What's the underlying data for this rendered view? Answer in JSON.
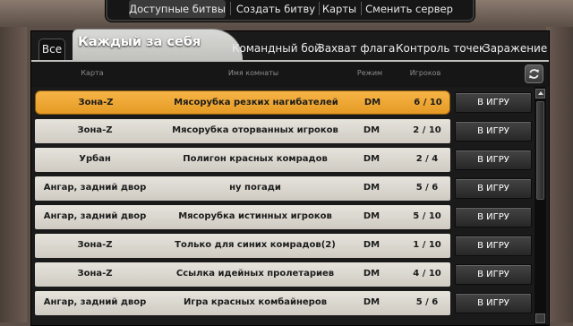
{
  "top_menu": {
    "items": [
      "Доступные битвы",
      "Создать битву",
      "Карты",
      "Сменить сервер"
    ],
    "active_index": 0
  },
  "tabs": {
    "all": "Все",
    "active": "Каждый за себя",
    "others": [
      "Командный бой",
      "Захват флага",
      "Контроль точек",
      "Заражение"
    ]
  },
  "table": {
    "headers": {
      "map": "Карта",
      "room": "Имя комнаты",
      "mode": "Режим",
      "players": "Игроков"
    },
    "refresh_icon": "refresh-icon",
    "rows": [
      {
        "map": "Зона-Z",
        "room": "Мясорубка резких нагибателей",
        "mode": "DM",
        "players": "6 / 10",
        "button": "В ИГРУ",
        "selected": true
      },
      {
        "map": "Зона-Z",
        "room": "Мясорубка оторванных игроков",
        "mode": "DM",
        "players": "2 / 10",
        "button": "В ИГРУ"
      },
      {
        "map": "Урбан",
        "room": "Полигон красных комрадов",
        "mode": "DM",
        "players": "2 / 4",
        "button": "В ИГРУ"
      },
      {
        "map": "Ангар, задний двор",
        "room": "ну погади",
        "mode": "DM",
        "players": "5 / 6",
        "button": "В ИГРУ"
      },
      {
        "map": "Ангар, задний двор",
        "room": "Мясорубка истинных игроков",
        "mode": "DM",
        "players": "5 / 10",
        "button": "В ИГРУ"
      },
      {
        "map": "Зона-Z",
        "room": "Только для синих комрадов(2)",
        "mode": "DM",
        "players": "1 / 10",
        "button": "В ИГРУ"
      },
      {
        "map": "Зона-Z",
        "room": "Ссылка идейных пролетариев",
        "mode": "DM",
        "players": "4 / 10",
        "button": "В ИГРУ"
      },
      {
        "map": "Ангар, задний двор",
        "room": "Игра красных комбайнеров",
        "mode": "DM",
        "players": "5 / 6",
        "button": "В ИГРУ"
      }
    ]
  },
  "colors": {
    "selected_row": "#f0a535",
    "row": "#dcd8d0",
    "panel": "#1a1a1a"
  }
}
